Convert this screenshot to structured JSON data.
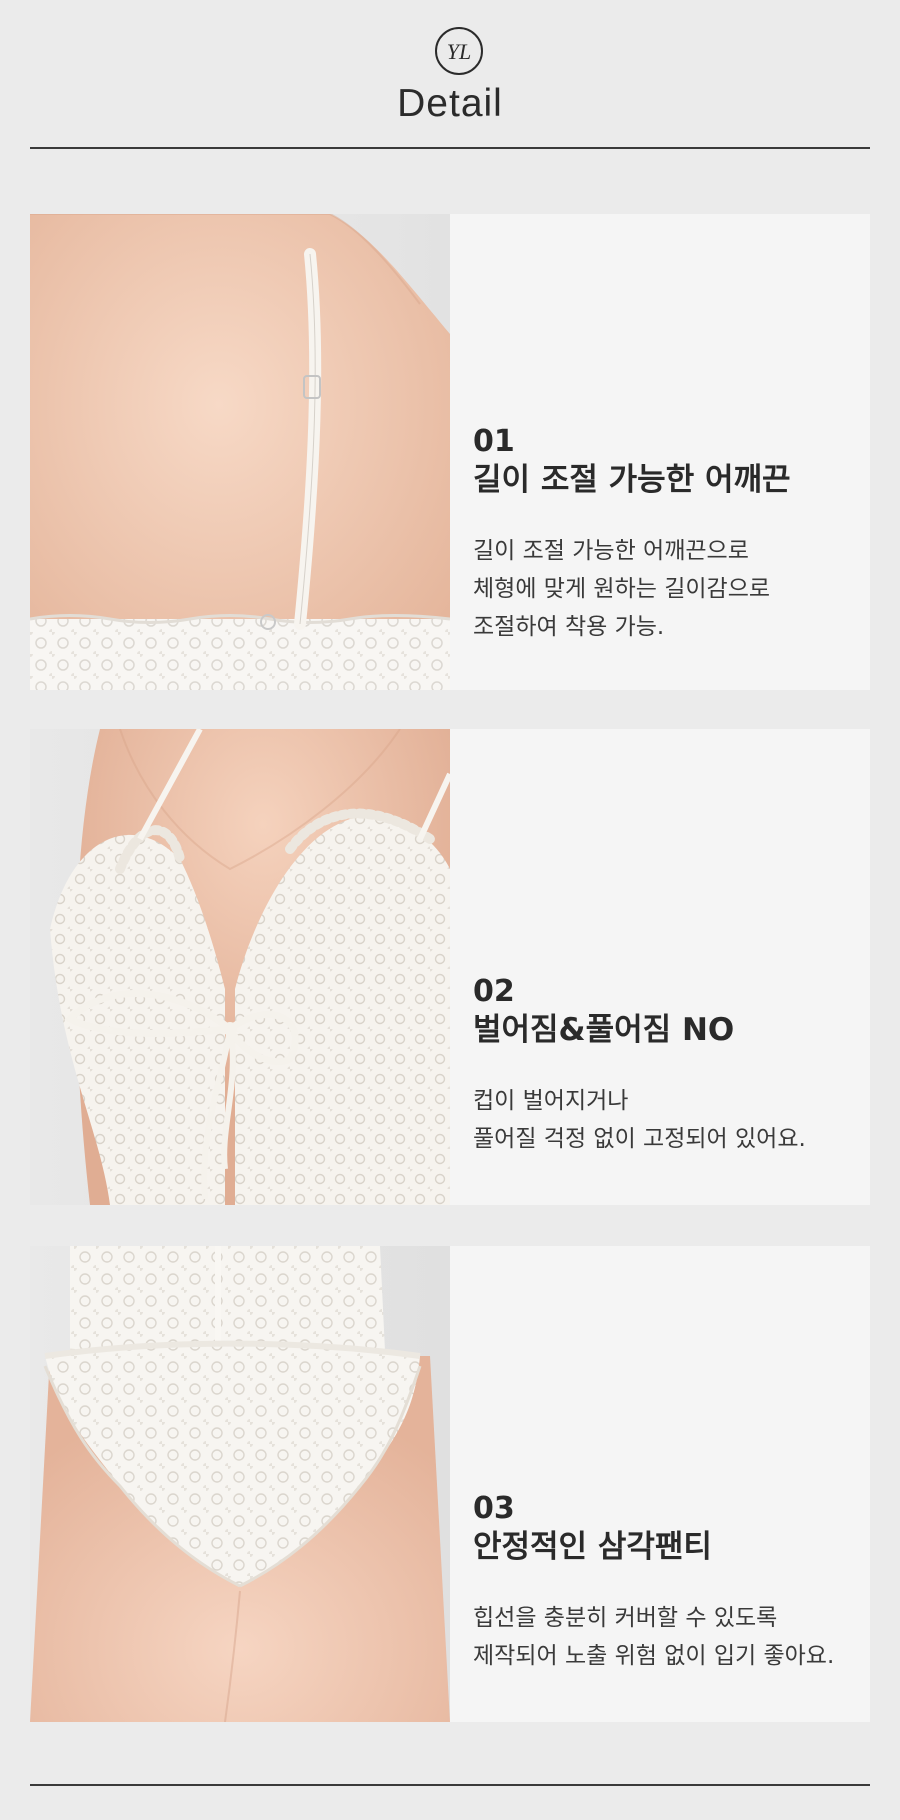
{
  "header": {
    "logo_text": "YL",
    "title": "Detail"
  },
  "sections": [
    {
      "number": "01",
      "heading": "길이 조절 가능한 어깨끈",
      "description": [
        "길이 조절 가능한 어깨끈으로",
        "체형에 맞게 원하는 길이감으로",
        "조절하여 착용 가능."
      ]
    },
    {
      "number": "02",
      "heading": "벌어짐&풀어짐 NO",
      "description": [
        "컵이 벌어지거나",
        "풀어질 걱정 없이 고정되어 있어요."
      ]
    },
    {
      "number": "03",
      "heading": "안정적인 삼각팬티",
      "description": [
        "힙선을 충분히 커버할 수 있도록",
        "제작되어 노출 위험 없이 입기 좋아요."
      ]
    }
  ],
  "colors": {
    "background": "#ebebeb",
    "panel": "#f5f5f5",
    "text": "#2a2a2a",
    "skin": "#f0c9b4",
    "lace": "#f7f5f2"
  }
}
